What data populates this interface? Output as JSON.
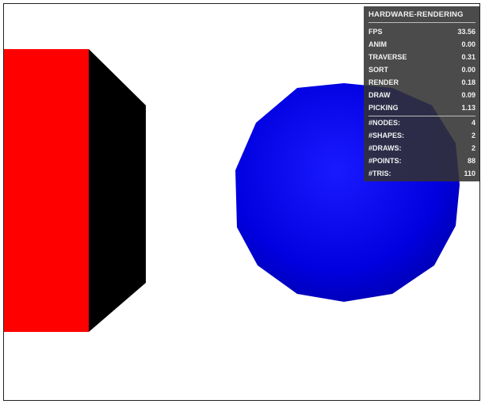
{
  "stats": {
    "title": "HARDWARE-RENDERING",
    "timing": [
      {
        "label": "FPS",
        "value": "33.56"
      },
      {
        "label": "ANIM",
        "value": "0.00"
      },
      {
        "label": "TRAVERSE",
        "value": "0.31"
      },
      {
        "label": "SORT",
        "value": "0.00"
      },
      {
        "label": "RENDER",
        "value": "0.18"
      },
      {
        "label": "DRAW",
        "value": "0.09"
      },
      {
        "label": "PICKING",
        "value": "1.13"
      }
    ],
    "counts": [
      {
        "label": "#NODES:",
        "value": "4"
      },
      {
        "label": "#SHAPES:",
        "value": "2"
      },
      {
        "label": "#DRAWS:",
        "value": "2"
      },
      {
        "label": "#POINTS:",
        "value": "88"
      },
      {
        "label": "#TRIS:",
        "value": "110"
      }
    ]
  },
  "colors": {
    "box_front": "#ff0000",
    "box_side": "#000000",
    "sphere": "#0000e6",
    "panel_bg": "#323232"
  }
}
